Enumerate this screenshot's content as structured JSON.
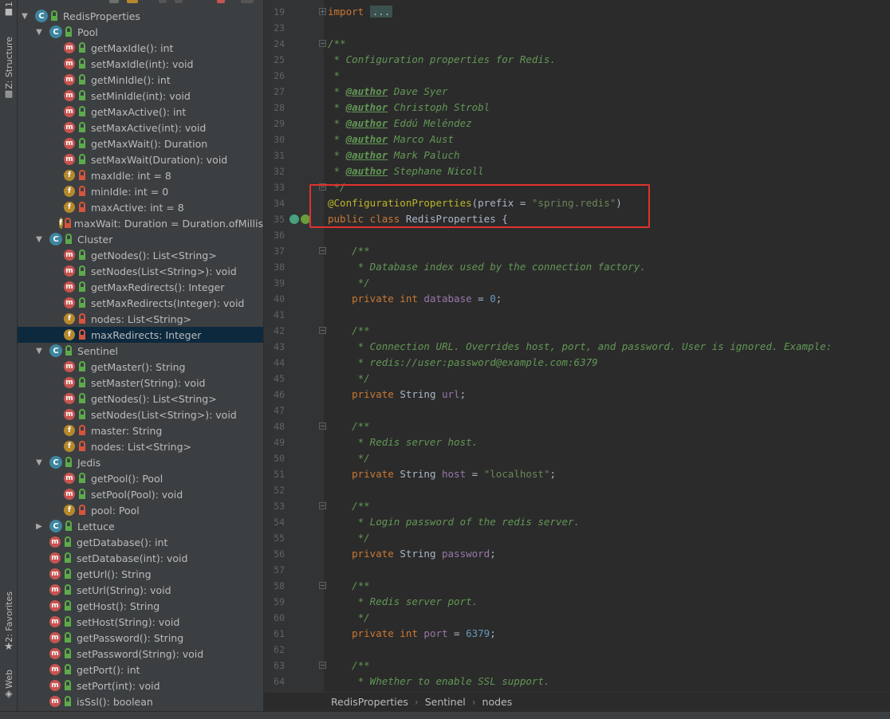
{
  "tool_strip": {
    "top_tab": "1",
    "structure_tab": "Z: Structure",
    "favorites_tab": "2: Favorites",
    "web_tab": "Web"
  },
  "structure": {
    "rows": [
      {
        "indent": 0,
        "arrow": "expanded",
        "kind": "class",
        "label": "RedisProperties"
      },
      {
        "indent": 1,
        "arrow": "expanded",
        "kind": "class",
        "label": "Pool"
      },
      {
        "indent": 2,
        "arrow": "none",
        "kind": "method",
        "access": "public",
        "label": "getMaxIdle(): int"
      },
      {
        "indent": 2,
        "arrow": "none",
        "kind": "method",
        "access": "public",
        "label": "setMaxIdle(int): void"
      },
      {
        "indent": 2,
        "arrow": "none",
        "kind": "method",
        "access": "public",
        "label": "getMinIdle(): int"
      },
      {
        "indent": 2,
        "arrow": "none",
        "kind": "method",
        "access": "public",
        "label": "setMinIdle(int): void"
      },
      {
        "indent": 2,
        "arrow": "none",
        "kind": "method",
        "access": "public",
        "label": "getMaxActive(): int"
      },
      {
        "indent": 2,
        "arrow": "none",
        "kind": "method",
        "access": "public",
        "label": "setMaxActive(int): void"
      },
      {
        "indent": 2,
        "arrow": "none",
        "kind": "method",
        "access": "public",
        "label": "getMaxWait(): Duration"
      },
      {
        "indent": 2,
        "arrow": "none",
        "kind": "method",
        "access": "public",
        "label": "setMaxWait(Duration): void"
      },
      {
        "indent": 2,
        "arrow": "none",
        "kind": "field",
        "access": "private",
        "label": "maxIdle: int = 8"
      },
      {
        "indent": 2,
        "arrow": "none",
        "kind": "field",
        "access": "private",
        "label": "minIdle: int = 0"
      },
      {
        "indent": 2,
        "arrow": "none",
        "kind": "field",
        "access": "private",
        "label": "maxActive: int = 8"
      },
      {
        "indent": 2,
        "arrow": "none",
        "kind": "field",
        "access": "private",
        "label": "maxWait: Duration = Duration.ofMillis"
      },
      {
        "indent": 1,
        "arrow": "expanded",
        "kind": "class",
        "label": "Cluster"
      },
      {
        "indent": 2,
        "arrow": "none",
        "kind": "method",
        "access": "public",
        "label": "getNodes(): List<String>"
      },
      {
        "indent": 2,
        "arrow": "none",
        "kind": "method",
        "access": "public",
        "label": "setNodes(List<String>): void"
      },
      {
        "indent": 2,
        "arrow": "none",
        "kind": "method",
        "access": "public",
        "label": "getMaxRedirects(): Integer"
      },
      {
        "indent": 2,
        "arrow": "none",
        "kind": "method",
        "access": "public",
        "label": "setMaxRedirects(Integer): void"
      },
      {
        "indent": 2,
        "arrow": "none",
        "kind": "field",
        "access": "private",
        "label": "nodes: List<String>"
      },
      {
        "indent": 2,
        "arrow": "none",
        "kind": "field",
        "access": "private",
        "label": "maxRedirects: Integer",
        "selected": true
      },
      {
        "indent": 1,
        "arrow": "expanded",
        "kind": "class",
        "label": "Sentinel"
      },
      {
        "indent": 2,
        "arrow": "none",
        "kind": "method",
        "access": "public",
        "label": "getMaster(): String"
      },
      {
        "indent": 2,
        "arrow": "none",
        "kind": "method",
        "access": "public",
        "label": "setMaster(String): void"
      },
      {
        "indent": 2,
        "arrow": "none",
        "kind": "method",
        "access": "public",
        "label": "getNodes(): List<String>"
      },
      {
        "indent": 2,
        "arrow": "none",
        "kind": "method",
        "access": "public",
        "label": "setNodes(List<String>): void"
      },
      {
        "indent": 2,
        "arrow": "none",
        "kind": "field",
        "access": "private",
        "label": "master: String"
      },
      {
        "indent": 2,
        "arrow": "none",
        "kind": "field",
        "access": "private",
        "label": "nodes: List<String>"
      },
      {
        "indent": 1,
        "arrow": "expanded",
        "kind": "class",
        "label": "Jedis"
      },
      {
        "indent": 2,
        "arrow": "none",
        "kind": "method",
        "access": "public",
        "label": "getPool(): Pool"
      },
      {
        "indent": 2,
        "arrow": "none",
        "kind": "method",
        "access": "public",
        "label": "setPool(Pool): void"
      },
      {
        "indent": 2,
        "arrow": "none",
        "kind": "field",
        "access": "private",
        "label": "pool: Pool"
      },
      {
        "indent": 1,
        "arrow": "collapsed",
        "kind": "class",
        "label": "Lettuce"
      },
      {
        "indent": 1,
        "arrow": "none",
        "kind": "method",
        "access": "public",
        "label": "getDatabase(): int"
      },
      {
        "indent": 1,
        "arrow": "none",
        "kind": "method",
        "access": "public",
        "label": "setDatabase(int): void"
      },
      {
        "indent": 1,
        "arrow": "none",
        "kind": "method",
        "access": "public",
        "label": "getUrl(): String"
      },
      {
        "indent": 1,
        "arrow": "none",
        "kind": "method",
        "access": "public",
        "label": "setUrl(String): void"
      },
      {
        "indent": 1,
        "arrow": "none",
        "kind": "method",
        "access": "public",
        "label": "getHost(): String"
      },
      {
        "indent": 1,
        "arrow": "none",
        "kind": "method",
        "access": "public",
        "label": "setHost(String): void"
      },
      {
        "indent": 1,
        "arrow": "none",
        "kind": "method",
        "access": "public",
        "label": "getPassword(): String"
      },
      {
        "indent": 1,
        "arrow": "none",
        "kind": "method",
        "access": "public",
        "label": "setPassword(String): void"
      },
      {
        "indent": 1,
        "arrow": "none",
        "kind": "method",
        "access": "public",
        "label": "getPort(): int"
      },
      {
        "indent": 1,
        "arrow": "none",
        "kind": "method",
        "access": "public",
        "label": "setPort(int): void"
      },
      {
        "indent": 1,
        "arrow": "none",
        "kind": "method",
        "access": "public",
        "label": "isSsl(): boolean"
      }
    ]
  },
  "editor": {
    "lines": [
      {
        "num": "19",
        "fold": "plus",
        "tokens": [
          [
            "kw",
            "import "
          ],
          [
            "chip",
            "..."
          ]
        ]
      },
      {
        "num": "23",
        "tokens": []
      },
      {
        "num": "24",
        "fold": "minus",
        "tokens": [
          [
            "cm",
            "/**"
          ]
        ]
      },
      {
        "num": "25",
        "tokens": [
          [
            "cm",
            " * Configuration properties for Redis."
          ]
        ]
      },
      {
        "num": "26",
        "tokens": [
          [
            "cm",
            " *"
          ]
        ]
      },
      {
        "num": "27",
        "tokens": [
          [
            "cm",
            " * "
          ],
          [
            "tag",
            "@author"
          ],
          [
            "cm",
            " Dave Syer"
          ]
        ]
      },
      {
        "num": "28",
        "tokens": [
          [
            "cm",
            " * "
          ],
          [
            "tag",
            "@author"
          ],
          [
            "cm",
            " Christoph Strobl"
          ]
        ]
      },
      {
        "num": "29",
        "tokens": [
          [
            "cm",
            " * "
          ],
          [
            "tag",
            "@author"
          ],
          [
            "cm",
            " Eddú Meléndez"
          ]
        ]
      },
      {
        "num": "30",
        "tokens": [
          [
            "cm",
            " * "
          ],
          [
            "tag",
            "@author"
          ],
          [
            "cm",
            " Marco Aust"
          ]
        ]
      },
      {
        "num": "31",
        "tokens": [
          [
            "cm",
            " * "
          ],
          [
            "tag",
            "@author"
          ],
          [
            "cm",
            " Mark Paluch"
          ]
        ]
      },
      {
        "num": "32",
        "tokens": [
          [
            "cm",
            " * "
          ],
          [
            "tag",
            "@author"
          ],
          [
            "cm",
            " Stephane Nicoll"
          ]
        ]
      },
      {
        "num": "33",
        "fold": "minus",
        "tokens": [
          [
            "cm",
            " */"
          ]
        ]
      },
      {
        "num": "34",
        "tokens": [
          [
            "ann",
            "@ConfigurationProperties"
          ],
          [
            "plain",
            "(prefix = "
          ],
          [
            "str",
            "\"spring.redis\""
          ],
          [
            "plain",
            ")"
          ]
        ]
      },
      {
        "num": "35",
        "gutter_icons": true,
        "tokens": [
          [
            "kw",
            "public class "
          ],
          [
            "plain",
            "RedisProperties {"
          ]
        ]
      },
      {
        "num": "36",
        "tokens": []
      },
      {
        "num": "37",
        "fold": "minus",
        "tokens": [
          [
            "cm",
            "    /**"
          ]
        ]
      },
      {
        "num": "38",
        "tokens": [
          [
            "cm",
            "     * Database index used by the connection factory."
          ]
        ]
      },
      {
        "num": "39",
        "tokens": [
          [
            "cm",
            "     */"
          ]
        ]
      },
      {
        "num": "40",
        "tokens": [
          [
            "kw",
            "    private int "
          ],
          [
            "fld",
            "database"
          ],
          [
            "plain",
            " = "
          ],
          [
            "num",
            "0"
          ],
          [
            "plain",
            ";"
          ]
        ]
      },
      {
        "num": "41",
        "tokens": []
      },
      {
        "num": "42",
        "fold": "minus",
        "tokens": [
          [
            "cm",
            "    /**"
          ]
        ]
      },
      {
        "num": "43",
        "tokens": [
          [
            "cm",
            "     * Connection URL. Overrides host, port, and password. User is ignored. Example:"
          ]
        ]
      },
      {
        "num": "44",
        "tokens": [
          [
            "cm",
            "     * redis://user:password@example.com:6379"
          ]
        ]
      },
      {
        "num": "45",
        "tokens": [
          [
            "cm",
            "     */"
          ]
        ]
      },
      {
        "num": "46",
        "tokens": [
          [
            "kw",
            "    private "
          ],
          [
            "plain",
            "String "
          ],
          [
            "fld",
            "url"
          ],
          [
            "plain",
            ";"
          ]
        ]
      },
      {
        "num": "47",
        "tokens": []
      },
      {
        "num": "48",
        "fold": "minus",
        "tokens": [
          [
            "cm",
            "    /**"
          ]
        ]
      },
      {
        "num": "49",
        "tokens": [
          [
            "cm",
            "     * Redis server host."
          ]
        ]
      },
      {
        "num": "50",
        "tokens": [
          [
            "cm",
            "     */"
          ]
        ]
      },
      {
        "num": "51",
        "tokens": [
          [
            "kw",
            "    private "
          ],
          [
            "plain",
            "String "
          ],
          [
            "fld",
            "host"
          ],
          [
            "plain",
            " = "
          ],
          [
            "str",
            "\"localhost\""
          ],
          [
            "plain",
            ";"
          ]
        ]
      },
      {
        "num": "52",
        "tokens": []
      },
      {
        "num": "53",
        "fold": "minus",
        "tokens": [
          [
            "cm",
            "    /**"
          ]
        ]
      },
      {
        "num": "54",
        "tokens": [
          [
            "cm",
            "     * Login password of the redis server."
          ]
        ]
      },
      {
        "num": "55",
        "tokens": [
          [
            "cm",
            "     */"
          ]
        ]
      },
      {
        "num": "56",
        "tokens": [
          [
            "kw",
            "    private "
          ],
          [
            "plain",
            "String "
          ],
          [
            "fld",
            "password"
          ],
          [
            "plain",
            ";"
          ]
        ]
      },
      {
        "num": "57",
        "tokens": []
      },
      {
        "num": "58",
        "fold": "minus",
        "tokens": [
          [
            "cm",
            "    /**"
          ]
        ]
      },
      {
        "num": "59",
        "tokens": [
          [
            "cm",
            "     * Redis server port."
          ]
        ]
      },
      {
        "num": "60",
        "tokens": [
          [
            "cm",
            "     */"
          ]
        ]
      },
      {
        "num": "61",
        "tokens": [
          [
            "kw",
            "    private int "
          ],
          [
            "fld",
            "port"
          ],
          [
            "plain",
            " = "
          ],
          [
            "num",
            "6379"
          ],
          [
            "plain",
            ";"
          ]
        ]
      },
      {
        "num": "62",
        "tokens": []
      },
      {
        "num": "63",
        "fold": "minus",
        "tokens": [
          [
            "cm",
            "    /**"
          ]
        ]
      },
      {
        "num": "64",
        "tokens": [
          [
            "cm",
            "     * Whether to enable SSL support."
          ]
        ]
      }
    ]
  },
  "breadcrumb": {
    "items": [
      "RedisProperties",
      "Sentinel",
      "nodes"
    ]
  },
  "colors": {
    "highlight_box": "#e0322c",
    "selection": "#0d293e"
  }
}
